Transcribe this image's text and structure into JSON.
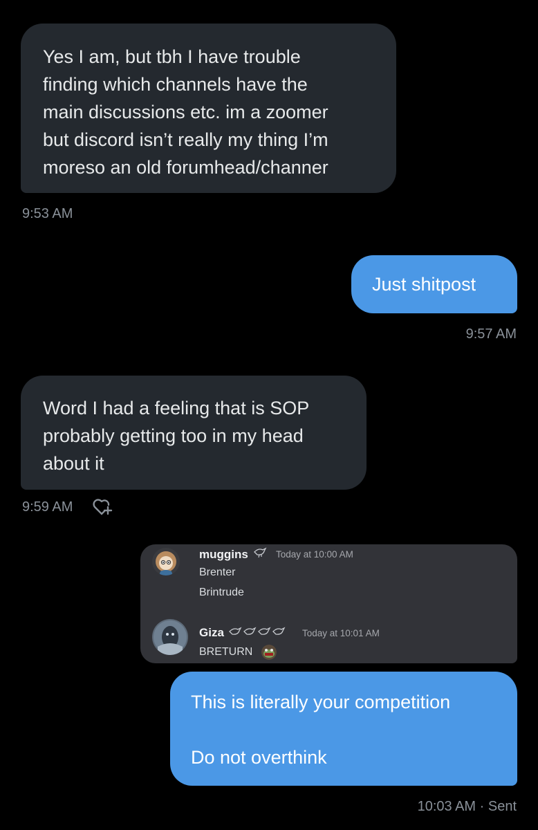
{
  "messages": [
    {
      "lines": [
        "Yes I am, but tbh I have trouble",
        "finding which channels have the",
        "main discussions etc. im a zoomer",
        "but discord isn’t really my thing I’m",
        "moreso an old forumhead/channer"
      ],
      "time": "9:53 AM"
    },
    {
      "lines": [
        "Just shitpost"
      ],
      "time": "9:57 AM"
    },
    {
      "lines": [
        "Word I had a feeling that is SOP",
        "probably getting too in my head",
        "about it"
      ],
      "time": "9:59 AM",
      "reaction_icon": "heart-plus-icon"
    },
    {
      "lines": [
        "This is literally your competition",
        "",
        "Do not overthink"
      ],
      "time": "10:03 AM · Sent"
    }
  ],
  "discord_embed": {
    "posts": [
      {
        "username": "muggins",
        "badge_icon": "bird-icon",
        "timestamp": "Today at 10:00 AM",
        "lines": [
          "Brenter",
          "Brintrude"
        ]
      },
      {
        "username": "Giza",
        "badge_icons": [
          "bird-icon",
          "bird-icon",
          "bird-icon",
          "bird-icon"
        ],
        "timestamp": "Today at 10:01 AM",
        "lines": [
          "BRETURN"
        ],
        "emote_icon": "frog-emote-icon"
      }
    ]
  },
  "colors": {
    "background": "#000000",
    "received_bubble": "#24292f",
    "sent_bubble": "#4b98e6",
    "timestamp": "#8a9199",
    "discord_background": "#323338"
  }
}
